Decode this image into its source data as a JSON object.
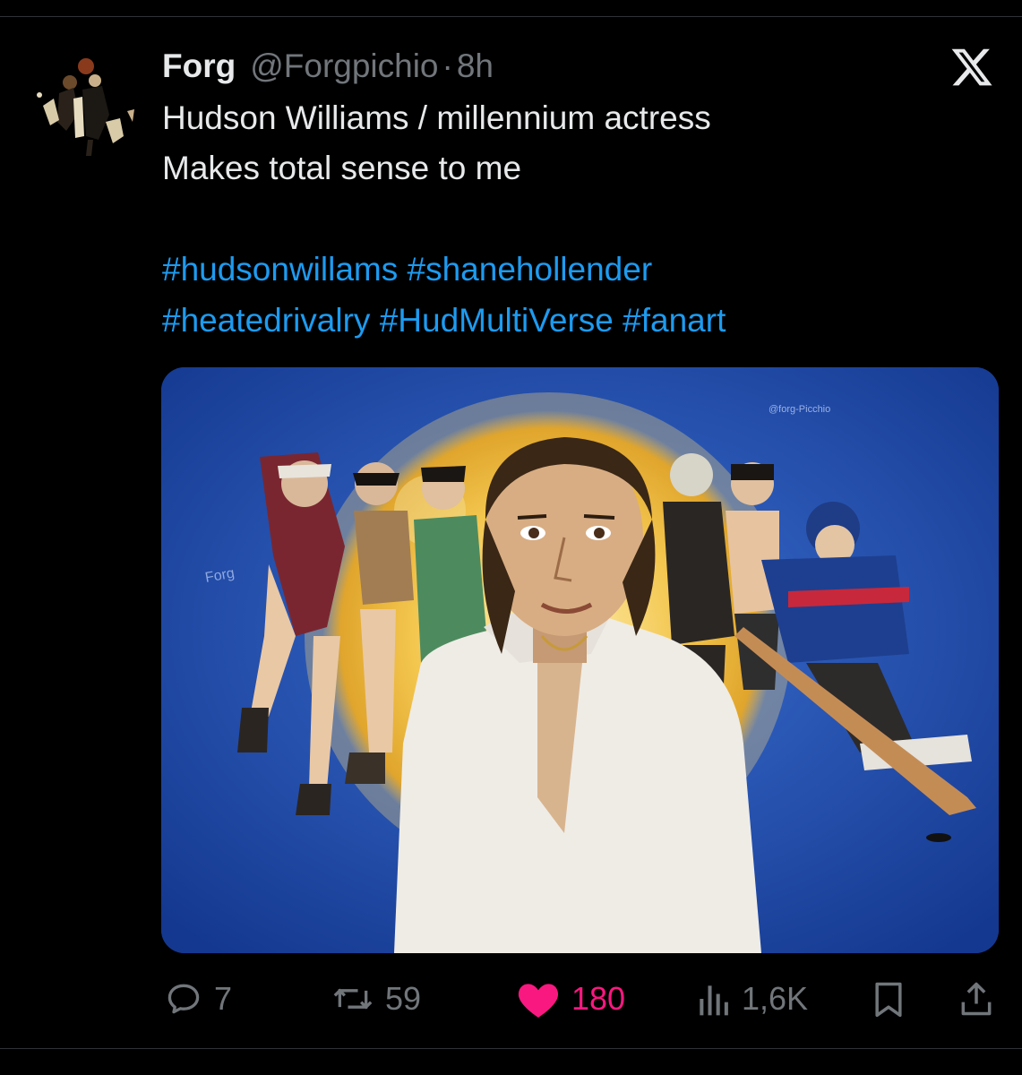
{
  "post": {
    "author": {
      "display_name": "Forg",
      "handle": "@Forgpichio",
      "separator": "·",
      "time": "8h",
      "avatar_icon": "avatar-illustration"
    },
    "text_lines": [
      "Hudson Williams / millennium actress",
      "Makes total sense to me"
    ],
    "hashtag_lines": [
      [
        "#hudsonwillams",
        "#shanehollender"
      ],
      [
        "#heatedrivalry",
        "#HudMultiVerse",
        "#fanart"
      ]
    ],
    "media": {
      "type": "illustration",
      "signature": "Forg",
      "watermark": "@forg-Picchio"
    },
    "actions": {
      "reply": {
        "icon": "reply-icon",
        "count": "7"
      },
      "repost": {
        "icon": "repost-icon",
        "count": "59"
      },
      "like": {
        "icon": "heart-icon",
        "count": "180",
        "active": true
      },
      "views": {
        "icon": "views-icon",
        "count": "1,6K"
      },
      "bookmark": {
        "icon": "bookmark-icon"
      },
      "share": {
        "icon": "share-icon"
      }
    }
  },
  "brand": {
    "logo": "x-logo-icon"
  },
  "colors": {
    "background": "#000000",
    "text": "#e7e9ea",
    "muted": "#71767b",
    "link": "#1d9bf0",
    "like": "#f91880"
  }
}
